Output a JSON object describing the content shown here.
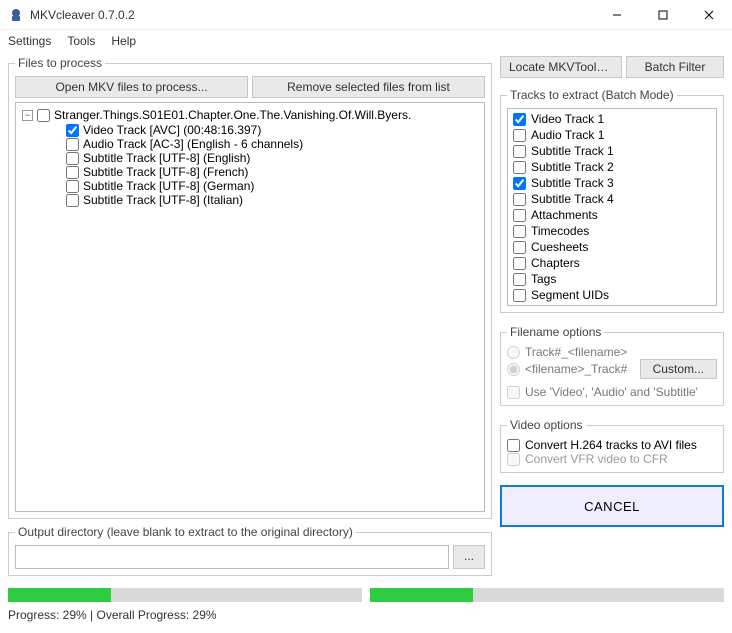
{
  "window": {
    "title": "MKVcleaver 0.7.0.2"
  },
  "menu": {
    "settings": "Settings",
    "tools": "Tools",
    "help": "Help"
  },
  "files_group": {
    "legend": "Files to process",
    "open_btn": "Open MKV files to process...",
    "remove_btn": "Remove selected files from list",
    "file": {
      "name": "Stranger.Things.S01E01.Chapter.One.The.Vanishing.Of.Will.Byers.",
      "checked": false,
      "tracks": [
        {
          "label": "Video Track [AVC] (00:48:16.397)",
          "checked": true
        },
        {
          "label": "Audio Track [AC-3] (English - 6 channels)",
          "checked": false
        },
        {
          "label": "Subtitle Track [UTF-8] (English)",
          "checked": false
        },
        {
          "label": "Subtitle Track [UTF-8] (French)",
          "checked": false
        },
        {
          "label": "Subtitle Track [UTF-8] (German)",
          "checked": false
        },
        {
          "label": "Subtitle Track [UTF-8] (Italian)",
          "checked": false
        }
      ]
    }
  },
  "top_right": {
    "locate_btn": "Locate MKVToolNix...",
    "batch_btn": "Batch Filter"
  },
  "tracks_group": {
    "legend": "Tracks to extract (Batch Mode)",
    "items": [
      {
        "label": "Video Track 1",
        "checked": true
      },
      {
        "label": "Audio Track 1",
        "checked": false
      },
      {
        "label": "Subtitle Track 1",
        "checked": false
      },
      {
        "label": "Subtitle Track 2",
        "checked": false
      },
      {
        "label": "Subtitle Track 3",
        "checked": true
      },
      {
        "label": "Subtitle Track 4",
        "checked": false
      },
      {
        "label": "Attachments",
        "checked": false
      },
      {
        "label": "Timecodes",
        "checked": false
      },
      {
        "label": "Cuesheets",
        "checked": false
      },
      {
        "label": "Chapters",
        "checked": false
      },
      {
        "label": "Tags",
        "checked": false
      },
      {
        "label": "Segment UIDs",
        "checked": false
      }
    ]
  },
  "filename_group": {
    "legend": "Filename options",
    "radio1": "Track#_<filename>",
    "radio2": "<filename>_Track#",
    "custom_btn": "Custom...",
    "use_types": "Use 'Video', 'Audio' and 'Subtitle'"
  },
  "video_group": {
    "legend": "Video options",
    "opt1": "Convert H.264 tracks to AVI files",
    "opt2": "Convert VFR video to CFR"
  },
  "output_group": {
    "legend": "Output directory (leave blank to extract to the original directory)",
    "value": "",
    "browse": "..."
  },
  "cancel_btn": "CANCEL",
  "progress": {
    "p1_percent": 29,
    "p2_percent": 29,
    "status": "Progress: 29% | Overall Progress: 29%"
  }
}
